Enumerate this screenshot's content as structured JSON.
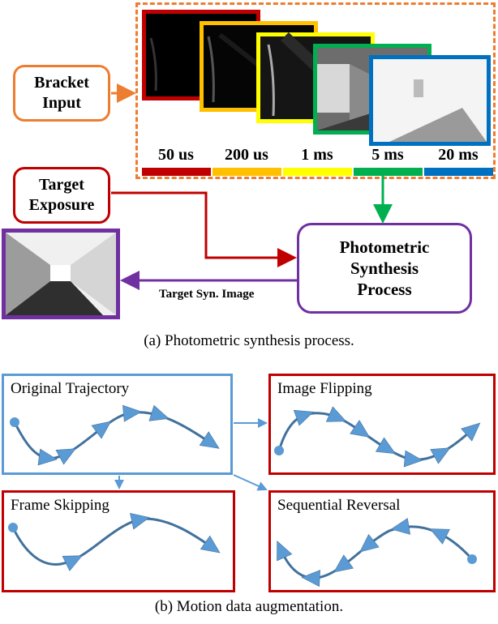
{
  "part_a": {
    "bracket_input_label": "Bracket\nInput",
    "bracket_line1": "Bracket",
    "bracket_line2": "Input",
    "target_exposure_line1": "Target",
    "target_exposure_line2": "Exposure",
    "synthesis_line1": "Photometric",
    "synthesis_line2": "Synthesis",
    "synthesis_line3": "Process",
    "output_arrow_label": "Target Syn. Image",
    "exposures": [
      {
        "label": "50 us",
        "color": "#c00000"
      },
      {
        "label": "200 us",
        "color": "#ffc000"
      },
      {
        "label": "1 ms",
        "color": "#ffff00"
      },
      {
        "label": "5 ms",
        "color": "#00b050"
      },
      {
        "label": "20 ms",
        "color": "#0070c0"
      }
    ],
    "colors": {
      "bracket": "#ed7d31",
      "target": "#c00000",
      "synthesis": "#7030a0",
      "green_arrow": "#00b050"
    },
    "caption": "(a)  Photometric synthesis process."
  },
  "part_b": {
    "panels": [
      {
        "title": "Original Trajectory",
        "kind": "original"
      },
      {
        "title": "Image Flipping",
        "kind": "flipped"
      },
      {
        "title": "Frame Skipping",
        "kind": "skipped"
      },
      {
        "title": "Sequential Reversal",
        "kind": "reversed"
      }
    ],
    "colors": {
      "source_border": "#5b9bd5",
      "augment_border": "#c00000",
      "trajectory": "#41719c",
      "arrowhead": "#5b9bd5"
    },
    "caption": "(b)  Motion data augmentation."
  }
}
